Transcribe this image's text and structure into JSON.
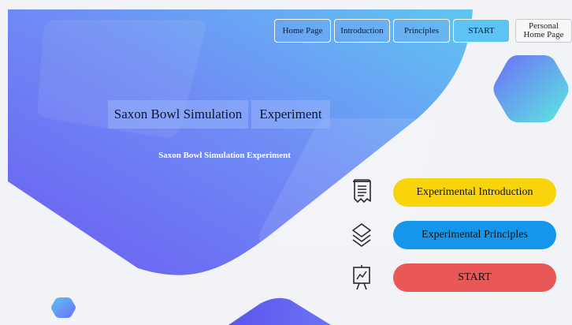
{
  "nav": {
    "home": "Home Page",
    "introduction": "Introduction",
    "principles": "Principles",
    "start": "START",
    "personal": "Personal Home Page"
  },
  "hero": {
    "title_part1": "Saxon Bowl Simulation",
    "title_part2": "Experiment",
    "subtitle": "Saxon Bowl Simulation Experiment"
  },
  "actions": [
    {
      "label": "Experimental Introduction",
      "color": "#f9d40a",
      "icon": "scroll-icon"
    },
    {
      "label": "Experimental Principles",
      "color": "#1596ea",
      "icon": "layers-icon"
    },
    {
      "label": "START",
      "color": "#ea5757",
      "icon": "presentation-chart-icon"
    }
  ],
  "colors": {
    "background": "#f2f3f7",
    "hero_gradient_start": "#6a6ff5",
    "hero_gradient_end": "#5fc4f3",
    "nav_active": "#5cc3f2",
    "hexagon_start": "#6d6ff6",
    "hexagon_end": "#5ce6e4"
  }
}
